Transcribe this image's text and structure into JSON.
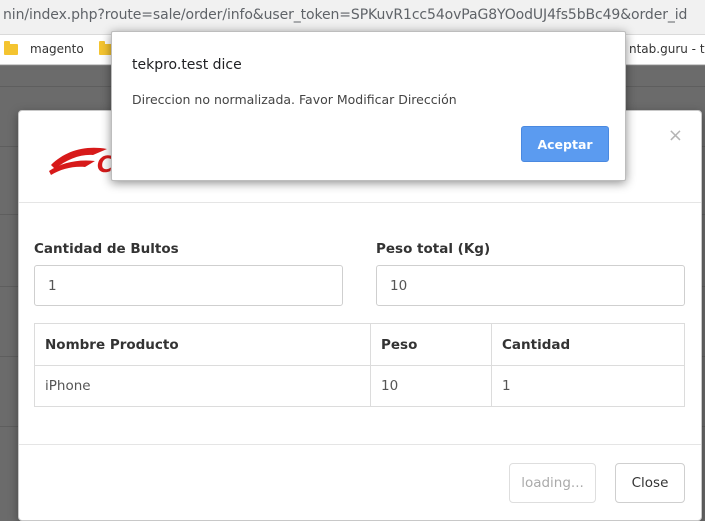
{
  "browser": {
    "url": "nin/index.php?route=sale/order/info&user_token=SPKuvR1cc54ovPaG8YOodUJ4fs5bBc49&order_id",
    "bookmarks": [
      {
        "label": "magento"
      },
      {
        "label": ""
      },
      {
        "label": "ntab.guru - th"
      }
    ]
  },
  "alert": {
    "title": "tekpro.test dice",
    "message": "Direccion no normalizada. Favor Modificar Dirección",
    "ok_label": "Aceptar"
  },
  "modal": {
    "close_icon": "×",
    "logo_text": "CO",
    "fields": {
      "bultos_label": "Cantidad de Bultos",
      "bultos_value": "1",
      "peso_label": "Peso total (Kg)",
      "peso_value": "10"
    },
    "table": {
      "headers": [
        "Nombre Producto",
        "Peso",
        "Cantidad"
      ],
      "rows": [
        [
          "iPhone",
          "10",
          "1"
        ]
      ]
    },
    "footer": {
      "loading_label": "loading...",
      "close_label": "Close"
    }
  },
  "colors": {
    "accent_blue": "#5b9bf0",
    "logo_red": "#d71a1a"
  }
}
